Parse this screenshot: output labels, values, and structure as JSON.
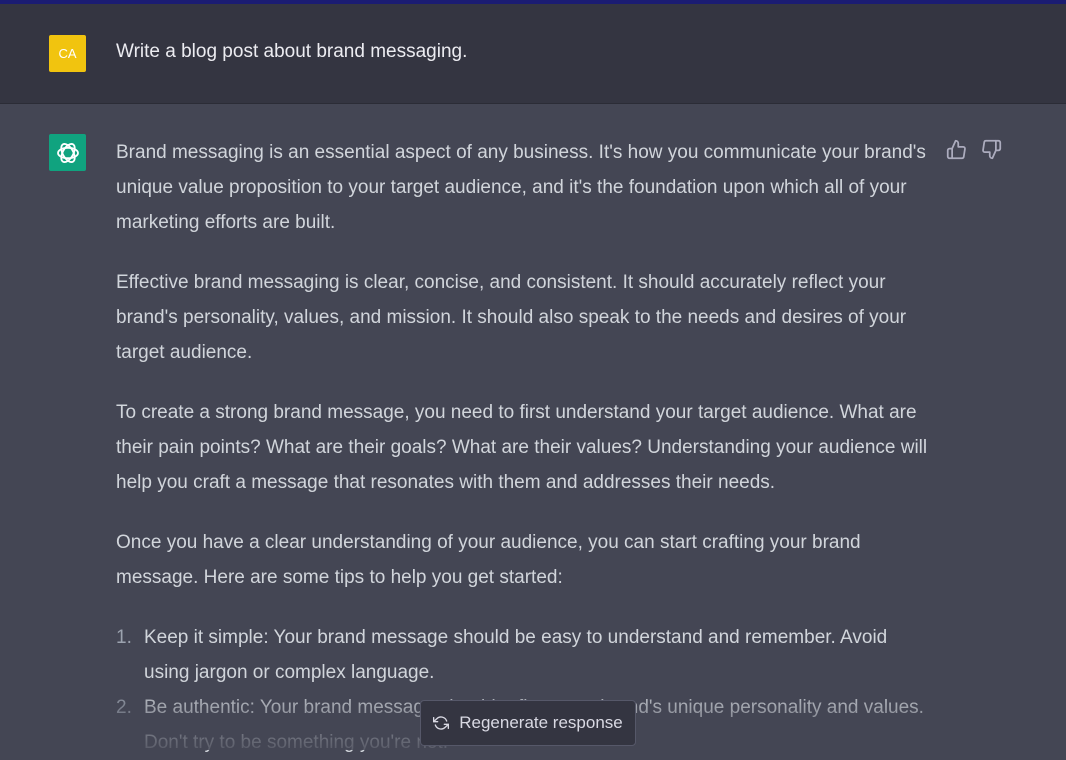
{
  "user": {
    "avatar_initials": "CA",
    "message": "Write a blog post about brand messaging."
  },
  "assistant": {
    "paragraphs": [
      "Brand messaging is an essential aspect of any business. It's how you communicate your brand's unique value proposition to your target audience, and it's the foundation upon which all of your marketing efforts are built.",
      "Effective brand messaging is clear, concise, and consistent. It should accurately reflect your brand's personality, values, and mission. It should also speak to the needs and desires of your target audience.",
      "To create a strong brand message, you need to first understand your target audience. What are their pain points? What are their goals? What are their values? Understanding your audience will help you craft a message that resonates with them and addresses their needs.",
      "Once you have a clear understanding of your audience, you can start crafting your brand message. Here are some tips to help you get started:"
    ],
    "list": [
      {
        "num": "1.",
        "text": "Keep it simple: Your brand message should be easy to understand and remember. Avoid using jargon or complex language."
      },
      {
        "num": "2.",
        "text": "Be authentic: Your brand message should reflect your brand's unique personality and values. Don't try to be something you're not."
      }
    ]
  },
  "feedback": {
    "thumbs_up_icon": "thumbs-up-icon",
    "thumbs_down_icon": "thumbs-down-icon"
  },
  "controls": {
    "regenerate_label": "Regenerate response"
  },
  "colors": {
    "top_strip": "#1b1c72",
    "user_bg": "#343541",
    "assistant_bg": "#444654",
    "user_avatar": "#f1c40f",
    "assistant_avatar": "#10a37f"
  }
}
